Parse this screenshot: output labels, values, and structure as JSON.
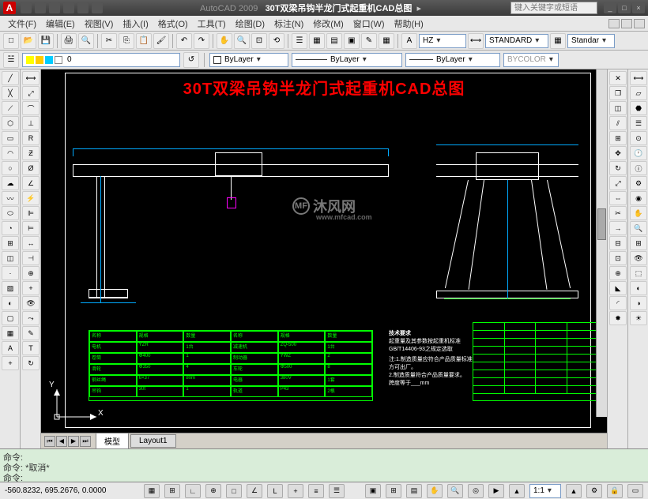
{
  "titlebar": {
    "app": "AutoCAD 2009",
    "doc": "30T双梁吊钩半龙门式起重机CAD总图",
    "search_placeholder": "键入关键字或短语",
    "min": "_",
    "max": "□",
    "close": "×"
  },
  "menubar": {
    "items": [
      "文件(F)",
      "编辑(E)",
      "视图(V)",
      "插入(I)",
      "格式(O)",
      "工具(T)",
      "绘图(D)",
      "标注(N)",
      "修改(M)",
      "窗口(W)",
      "帮助(H)"
    ]
  },
  "toolbar1_icons": [
    "new",
    "open",
    "save",
    "print",
    "preview",
    "cut",
    "copy",
    "paste",
    "match",
    "undo",
    "redo",
    "pan",
    "zoom",
    "zoom-ext",
    "props",
    "sheet",
    "tool-pal",
    "calc",
    "help"
  ],
  "textstyle": {
    "font": "HZ",
    "style": "STANDARD",
    "dimstyle": "Standar"
  },
  "layer_row": {
    "current_layer": "0",
    "layer_icons": [
      "light",
      "sun",
      "freeze",
      "lock",
      "color"
    ],
    "color": "ByLayer",
    "linetype": "ByLayer",
    "lineweight": "ByLayer",
    "plotstyle": "BYCOLOR"
  },
  "left_tools": [
    "line",
    "xline",
    "pline",
    "polygon",
    "rect",
    "arc",
    "circle",
    "revcloud",
    "spline",
    "ellipse",
    "ellipse-arc",
    "insert",
    "block",
    "point",
    "hatch",
    "gradient",
    "region",
    "table",
    "mtext",
    "addobj"
  ],
  "right_tools": [
    "erase",
    "copy",
    "mirror",
    "offset",
    "array",
    "move",
    "rotate",
    "scale",
    "stretch",
    "trim",
    "extend",
    "break-pt",
    "break",
    "join",
    "chamfer",
    "fillet",
    "explode"
  ],
  "drawing": {
    "title": "30T双梁吊钩半龙门式起重机CAD总图",
    "watermark": "沐风网",
    "watermark_url": "www.mfcad.com",
    "notes_heading": "技术要求",
    "notes": [
      "起重量及其参数按起重机标准",
      "GB/T14406-93之规定选取",
      "注:1.制造质量应符合产品质量标准",
      "方可出厂。",
      "2.制造质量符合产品质量要求。",
      "跨度等于___mm"
    ],
    "table_headers": [
      "名称",
      "规格",
      "数量",
      "名称",
      "规格",
      "数量"
    ],
    "table_rows": [
      [
        "电机",
        "YZR",
        "1台",
        "减速机",
        "ZQ-500",
        "1台"
      ],
      [
        "卷筒",
        "Φ400",
        "1",
        "制动器",
        "YWZ",
        "2"
      ],
      [
        "滑轮",
        "Φ350",
        "4",
        "车轮",
        "Φ500",
        "8"
      ],
      [
        "钢丝绳",
        "6×37",
        "80m",
        "电器",
        "380V",
        "1套"
      ],
      [
        "吊钩",
        "30t",
        "1",
        "轨道",
        "P43",
        "2根"
      ]
    ],
    "ucs_x": "X",
    "ucs_y": "Y"
  },
  "tabs": {
    "model": "模型",
    "layout1": "Layout1"
  },
  "cmd": {
    "line1": "命令:",
    "line2": "命令: *取消*",
    "prompt": "命令:"
  },
  "status": {
    "coords": "-560.8232, 695.2676, 0.0000",
    "buttons": [
      "snap",
      "grid",
      "ortho",
      "polar",
      "osnap",
      "otrack",
      "ducs",
      "dyn",
      "lwt",
      "qp"
    ],
    "scale": "1:1",
    "anno": "▲"
  }
}
